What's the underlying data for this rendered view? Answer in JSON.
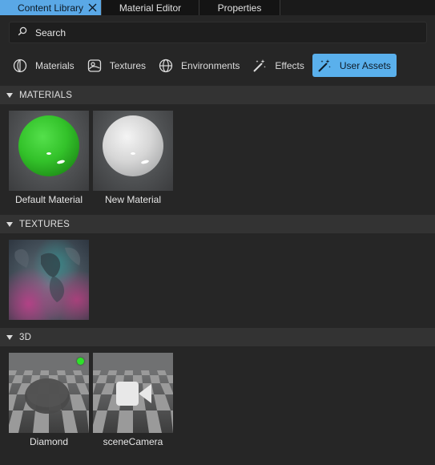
{
  "tabs": [
    {
      "label": "Content Library",
      "active": true
    },
    {
      "label": "Material Editor",
      "active": false
    },
    {
      "label": "Properties",
      "active": false
    }
  ],
  "search": {
    "placeholder": "Search",
    "icon": "search-icon"
  },
  "filters": [
    {
      "label": "Materials",
      "icon": "materials-icon",
      "active": false
    },
    {
      "label": "Textures",
      "icon": "textures-icon",
      "active": false
    },
    {
      "label": "Environments",
      "icon": "globe-icon",
      "active": false
    },
    {
      "label": "Effects",
      "icon": "magic-wand-icon",
      "active": false
    },
    {
      "label": "User Assets",
      "icon": "magic-wand-icon",
      "active": true
    }
  ],
  "sections": {
    "materials": {
      "title": "MATERIALS",
      "items": [
        {
          "label": "Default Material"
        },
        {
          "label": "New Material"
        }
      ]
    },
    "textures": {
      "title": "TEXTURES",
      "items": [
        {
          "label": ""
        }
      ]
    },
    "three_d": {
      "title": "3D",
      "items": [
        {
          "label": "Diamond",
          "status": "active"
        },
        {
          "label": "sceneCamera"
        }
      ]
    }
  },
  "colors": {
    "accent": "#5ab0ec",
    "background": "#262626",
    "section_header": "#333333",
    "status_green": "#2ee12a"
  }
}
